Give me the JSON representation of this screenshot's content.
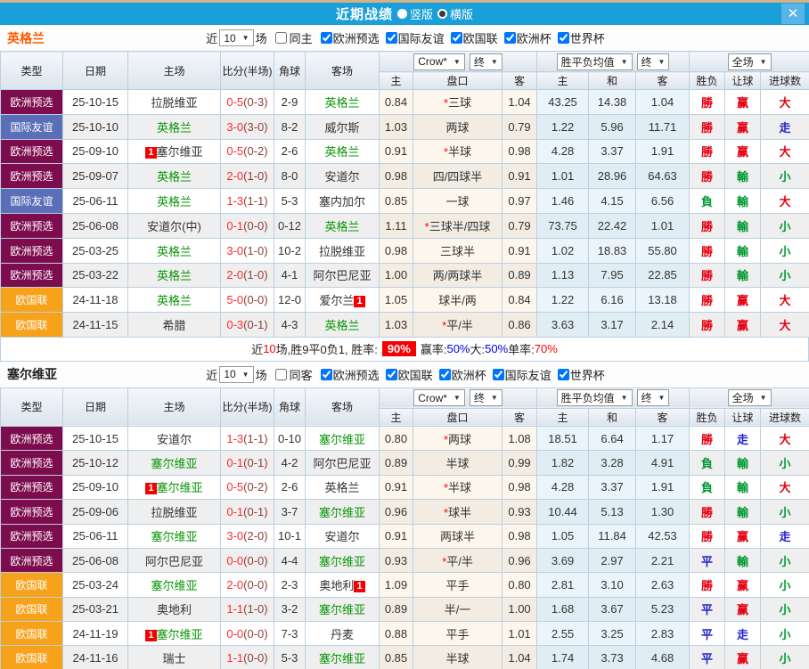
{
  "titlebar": {
    "title": "近期战绩",
    "radio_vertical": "竖版",
    "radio_horizontal": "横版",
    "close": "✕"
  },
  "colors": {
    "titlebar_bg": "#1b9fd8",
    "comp": {
      "欧洲预选": "#7d0c4e",
      "国际友谊": "#5a6fb8",
      "欧国联": "#f7a21b"
    },
    "result": {
      "勝": "#e60012",
      "負": "#009933",
      "平": "#2323cc",
      "赢": "#e60012",
      "輸": "#009933",
      "走": "#2323cc",
      "大": "#e60012",
      "小": "#009933"
    }
  },
  "header": {
    "type": "类型",
    "date": "日期",
    "home": "主场",
    "score": "比分(半场)",
    "corner": "角球",
    "away": "客场",
    "source": "Crow*",
    "final": "终",
    "wdl_mean": "胜平负均值",
    "full": "全场",
    "h": "主",
    "pan": "盘口",
    "a": "客",
    "h2": "主",
    "draw": "和",
    "a2": "客",
    "result": "胜负",
    "let": "让球",
    "goals": "进球数"
  },
  "sections": [
    {
      "team": "英格兰",
      "team_color": "#ff5a00",
      "filter": {
        "near": "近",
        "count": "10",
        "games": "场",
        "same": {
          "label": "同主",
          "checked": false
        },
        "comps": [
          {
            "label": "欧洲预选",
            "checked": true
          },
          {
            "label": "国际友谊",
            "checked": true
          },
          {
            "label": "欧国联",
            "checked": true
          },
          {
            "label": "欧洲杯",
            "checked": true
          },
          {
            "label": "世界杯",
            "checked": true
          }
        ]
      },
      "rows": [
        {
          "comp": "欧洲预选",
          "date": "25-10-15",
          "home": {
            "pre": "",
            "name": "拉脱维亚",
            "green": false,
            "post": ""
          },
          "ft": "0-5",
          "ht": "(0-3)",
          "corner": "2-9",
          "away": {
            "pre": "",
            "name": "英格兰",
            "green": true,
            "post": ""
          },
          "o1": "0.84",
          "star": "*",
          "pan": "三球",
          "o2": "1.04",
          "m1": "43.25",
          "m2": "14.38",
          "m3": "1.04",
          "r1": "勝",
          "r2": "赢",
          "r3": "大"
        },
        {
          "comp": "国际友谊",
          "date": "25-10-10",
          "home": {
            "pre": "",
            "name": "英格兰",
            "green": true,
            "post": ""
          },
          "ft": "3-0",
          "ht": "(3-0)",
          "corner": "8-2",
          "away": {
            "pre": "",
            "name": "威尔斯",
            "green": false,
            "post": ""
          },
          "o1": "1.03",
          "star": "",
          "pan": "两球",
          "o2": "0.79",
          "m1": "1.22",
          "m2": "5.96",
          "m3": "11.71",
          "r1": "勝",
          "r2": "赢",
          "r3": "走"
        },
        {
          "comp": "欧洲预选",
          "date": "25-09-10",
          "home": {
            "pre": "1",
            "name": "塞尔维亚",
            "green": false,
            "post": ""
          },
          "ft": "0-5",
          "ht": "(0-2)",
          "corner": "2-6",
          "away": {
            "pre": "",
            "name": "英格兰",
            "green": true,
            "post": ""
          },
          "o1": "0.91",
          "star": "*",
          "pan": "半球",
          "o2": "0.98",
          "m1": "4.28",
          "m2": "3.37",
          "m3": "1.91",
          "r1": "勝",
          "r2": "赢",
          "r3": "大"
        },
        {
          "comp": "欧洲预选",
          "date": "25-09-07",
          "home": {
            "pre": "",
            "name": "英格兰",
            "green": true,
            "post": ""
          },
          "ft": "2-0",
          "ht": "(1-0)",
          "corner": "8-0",
          "away": {
            "pre": "",
            "name": "安道尔",
            "green": false,
            "post": ""
          },
          "o1": "0.98",
          "star": "",
          "pan": "四/四球半",
          "o2": "0.91",
          "m1": "1.01",
          "m2": "28.96",
          "m3": "64.63",
          "r1": "勝",
          "r2": "輸",
          "r3": "小"
        },
        {
          "comp": "国际友谊",
          "date": "25-06-11",
          "home": {
            "pre": "",
            "name": "英格兰",
            "green": true,
            "post": ""
          },
          "ft": "1-3",
          "ht": "(1-1)",
          "corner": "5-3",
          "away": {
            "pre": "",
            "name": "塞内加尔",
            "green": false,
            "post": ""
          },
          "o1": "0.85",
          "star": "",
          "pan": "一球",
          "o2": "0.97",
          "m1": "1.46",
          "m2": "4.15",
          "m3": "6.56",
          "r1": "負",
          "r2": "輸",
          "r3": "大"
        },
        {
          "comp": "欧洲预选",
          "date": "25-06-08",
          "home": {
            "pre": "",
            "name": "安道尔(中)",
            "green": false,
            "post": ""
          },
          "ft": "0-1",
          "ht": "(0-0)",
          "corner": "0-12",
          "away": {
            "pre": "",
            "name": "英格兰",
            "green": true,
            "post": ""
          },
          "o1": "1.11",
          "star": "*",
          "pan": "三球半/四球",
          "o2": "0.79",
          "m1": "73.75",
          "m2": "22.42",
          "m3": "1.01",
          "r1": "勝",
          "r2": "輸",
          "r3": "小"
        },
        {
          "comp": "欧洲预选",
          "date": "25-03-25",
          "home": {
            "pre": "",
            "name": "英格兰",
            "green": true,
            "post": ""
          },
          "ft": "3-0",
          "ht": "(1-0)",
          "corner": "10-2",
          "away": {
            "pre": "",
            "name": "拉脱维亚",
            "green": false,
            "post": ""
          },
          "o1": "0.98",
          "star": "",
          "pan": "三球半",
          "o2": "0.91",
          "m1": "1.02",
          "m2": "18.83",
          "m3": "55.80",
          "r1": "勝",
          "r2": "輸",
          "r3": "小"
        },
        {
          "comp": "欧洲预选",
          "date": "25-03-22",
          "home": {
            "pre": "",
            "name": "英格兰",
            "green": true,
            "post": ""
          },
          "ft": "2-0",
          "ht": "(1-0)",
          "corner": "4-1",
          "away": {
            "pre": "",
            "name": "阿尔巴尼亚",
            "green": false,
            "post": ""
          },
          "o1": "1.00",
          "star": "",
          "pan": "两/两球半",
          "o2": "0.89",
          "m1": "1.13",
          "m2": "7.95",
          "m3": "22.85",
          "r1": "勝",
          "r2": "輸",
          "r3": "小"
        },
        {
          "comp": "欧国联",
          "date": "24-11-18",
          "home": {
            "pre": "",
            "name": "英格兰",
            "green": true,
            "post": ""
          },
          "ft": "5-0",
          "ht": "(0-0)",
          "corner": "12-0",
          "away": {
            "pre": "",
            "name": "爱尔兰",
            "green": false,
            "post": "1"
          },
          "o1": "1.05",
          "star": "",
          "pan": "球半/两",
          "o2": "0.84",
          "m1": "1.22",
          "m2": "6.16",
          "m3": "13.18",
          "r1": "勝",
          "r2": "赢",
          "r3": "大"
        },
        {
          "comp": "欧国联",
          "date": "24-11-15",
          "home": {
            "pre": "",
            "name": "希腊",
            "green": false,
            "post": ""
          },
          "ft": "0-3",
          "ht": "(0-1)",
          "corner": "4-3",
          "away": {
            "pre": "",
            "name": "英格兰",
            "green": true,
            "post": ""
          },
          "o1": "1.03",
          "star": "*",
          "pan": "平/半",
          "o2": "0.86",
          "m1": "3.63",
          "m2": "3.17",
          "m3": "2.14",
          "r1": "勝",
          "r2": "赢",
          "r3": "大"
        }
      ],
      "summary": [
        {
          "t": "近",
          "c": "k"
        },
        {
          "t": "10",
          "c": "r"
        },
        {
          "t": "场,胜9平0负1, 胜率:",
          "c": "k"
        },
        {
          "t": "90%",
          "c": "badge"
        },
        {
          "t": "赢率:",
          "c": "k"
        },
        {
          "t": "50%",
          "c": "b"
        },
        {
          "t": " 大:",
          "c": "k"
        },
        {
          "t": "50%",
          "c": "b"
        },
        {
          "t": " 单率:",
          "c": "k"
        },
        {
          "t": "70%",
          "c": "r"
        }
      ]
    },
    {
      "team": "塞尔维亚",
      "team_color": "#222222",
      "filter": {
        "near": "近",
        "count": "10",
        "games": "场",
        "same": {
          "label": "同客",
          "checked": false
        },
        "comps": [
          {
            "label": "欧洲预选",
            "checked": true
          },
          {
            "label": "欧国联",
            "checked": true
          },
          {
            "label": "欧洲杯",
            "checked": true
          },
          {
            "label": "国际友谊",
            "checked": true
          },
          {
            "label": "世界杯",
            "checked": true
          }
        ]
      },
      "rows": [
        {
          "comp": "欧洲预选",
          "date": "25-10-15",
          "home": {
            "pre": "",
            "name": "安道尔",
            "green": false,
            "post": ""
          },
          "ft": "1-3",
          "ht": "(1-1)",
          "corner": "0-10",
          "away": {
            "pre": "",
            "name": "塞尔维亚",
            "green": true,
            "post": ""
          },
          "o1": "0.80",
          "star": "*",
          "pan": "两球",
          "o2": "1.08",
          "m1": "18.51",
          "m2": "6.64",
          "m3": "1.17",
          "r1": "勝",
          "r2": "走",
          "r3": "大"
        },
        {
          "comp": "欧洲预选",
          "date": "25-10-12",
          "home": {
            "pre": "",
            "name": "塞尔维亚",
            "green": true,
            "post": ""
          },
          "ft": "0-1",
          "ht": "(0-1)",
          "corner": "4-2",
          "away": {
            "pre": "",
            "name": "阿尔巴尼亚",
            "green": false,
            "post": ""
          },
          "o1": "0.89",
          "star": "",
          "pan": "半球",
          "o2": "0.99",
          "m1": "1.82",
          "m2": "3.28",
          "m3": "4.91",
          "r1": "負",
          "r2": "輸",
          "r3": "小"
        },
        {
          "comp": "欧洲预选",
          "date": "25-09-10",
          "home": {
            "pre": "1",
            "name": "塞尔维亚",
            "green": true,
            "post": ""
          },
          "ft": "0-5",
          "ht": "(0-2)",
          "corner": "2-6",
          "away": {
            "pre": "",
            "name": "英格兰",
            "green": false,
            "post": ""
          },
          "o1": "0.91",
          "star": "*",
          "pan": "半球",
          "o2": "0.98",
          "m1": "4.28",
          "m2": "3.37",
          "m3": "1.91",
          "r1": "負",
          "r2": "輸",
          "r3": "大"
        },
        {
          "comp": "欧洲预选",
          "date": "25-09-06",
          "home": {
            "pre": "",
            "name": "拉脱维亚",
            "green": false,
            "post": ""
          },
          "ft": "0-1",
          "ht": "(0-1)",
          "corner": "3-7",
          "away": {
            "pre": "",
            "name": "塞尔维亚",
            "green": true,
            "post": ""
          },
          "o1": "0.96",
          "star": "*",
          "pan": "球半",
          "o2": "0.93",
          "m1": "10.44",
          "m2": "5.13",
          "m3": "1.30",
          "r1": "勝",
          "r2": "輸",
          "r3": "小"
        },
        {
          "comp": "欧洲预选",
          "date": "25-06-11",
          "home": {
            "pre": "",
            "name": "塞尔维亚",
            "green": true,
            "post": ""
          },
          "ft": "3-0",
          "ht": "(2-0)",
          "corner": "10-1",
          "away": {
            "pre": "",
            "name": "安道尔",
            "green": false,
            "post": ""
          },
          "o1": "0.91",
          "star": "",
          "pan": "两球半",
          "o2": "0.98",
          "m1": "1.05",
          "m2": "11.84",
          "m3": "42.53",
          "r1": "勝",
          "r2": "赢",
          "r3": "走"
        },
        {
          "comp": "欧洲预选",
          "date": "25-06-08",
          "home": {
            "pre": "",
            "name": "阿尔巴尼亚",
            "green": false,
            "post": ""
          },
          "ft": "0-0",
          "ht": "(0-0)",
          "corner": "4-4",
          "away": {
            "pre": "",
            "name": "塞尔维亚",
            "green": true,
            "post": ""
          },
          "o1": "0.93",
          "star": "*",
          "pan": "平/半",
          "o2": "0.96",
          "m1": "3.69",
          "m2": "2.97",
          "m3": "2.21",
          "r1": "平",
          "r2": "輸",
          "r3": "小"
        },
        {
          "comp": "欧国联",
          "date": "25-03-24",
          "home": {
            "pre": "",
            "name": "塞尔维亚",
            "green": true,
            "post": ""
          },
          "ft": "2-0",
          "ht": "(0-0)",
          "corner": "2-3",
          "away": {
            "pre": "",
            "name": "奥地利",
            "green": false,
            "post": "1"
          },
          "o1": "1.09",
          "star": "",
          "pan": "平手",
          "o2": "0.80",
          "m1": "2.81",
          "m2": "3.10",
          "m3": "2.63",
          "r1": "勝",
          "r2": "赢",
          "r3": "小"
        },
        {
          "comp": "欧国联",
          "date": "25-03-21",
          "home": {
            "pre": "",
            "name": "奥地利",
            "green": false,
            "post": ""
          },
          "ft": "1-1",
          "ht": "(1-0)",
          "corner": "3-2",
          "away": {
            "pre": "",
            "name": "塞尔维亚",
            "green": true,
            "post": ""
          },
          "o1": "0.89",
          "star": "",
          "pan": "半/一",
          "o2": "1.00",
          "m1": "1.68",
          "m2": "3.67",
          "m3": "5.23",
          "r1": "平",
          "r2": "赢",
          "r3": "小"
        },
        {
          "comp": "欧国联",
          "date": "24-11-19",
          "home": {
            "pre": "1",
            "name": "塞尔维亚",
            "green": true,
            "post": ""
          },
          "ft": "0-0",
          "ht": "(0-0)",
          "corner": "7-3",
          "away": {
            "pre": "",
            "name": "丹麦",
            "green": false,
            "post": ""
          },
          "o1": "0.88",
          "star": "",
          "pan": "平手",
          "o2": "1.01",
          "m1": "2.55",
          "m2": "3.25",
          "m3": "2.83",
          "r1": "平",
          "r2": "走",
          "r3": "小"
        },
        {
          "comp": "欧国联",
          "date": "24-11-16",
          "home": {
            "pre": "",
            "name": "瑞士",
            "green": false,
            "post": ""
          },
          "ft": "1-1",
          "ht": "(0-0)",
          "corner": "5-3",
          "away": {
            "pre": "",
            "name": "塞尔维亚",
            "green": true,
            "post": ""
          },
          "o1": "0.85",
          "star": "",
          "pan": "半球",
          "o2": "1.04",
          "m1": "1.74",
          "m2": "3.73",
          "m3": "4.68",
          "r1": "平",
          "r2": "赢",
          "r3": "小"
        }
      ],
      "summary": null
    }
  ]
}
